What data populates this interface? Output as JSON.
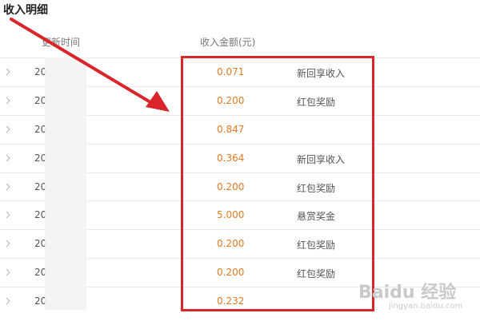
{
  "page": {
    "title": "收入明细"
  },
  "table": {
    "headers": {
      "time": "更新时间",
      "amount": "收入金额(元)"
    },
    "rows": [
      {
        "time": "20",
        "amount": "0.071",
        "source": "新回享收入"
      },
      {
        "time": "20",
        "amount": "0.200",
        "source": "红包奖励"
      },
      {
        "time": "20",
        "amount": "0.847",
        "source": ""
      },
      {
        "time": "20",
        "amount": "0.364",
        "source": "新回享收入"
      },
      {
        "time": "20",
        "amount": "0.200",
        "source": "红包奖励"
      },
      {
        "time": "20",
        "amount": "5.000",
        "source": "悬赏奖金"
      },
      {
        "time": "20",
        "amount": "0.200",
        "source": "红包奖励"
      },
      {
        "time": "20",
        "amount": "0.200",
        "source": "红包奖励"
      },
      {
        "time": "20",
        "amount": "0.232",
        "source": ""
      }
    ]
  },
  "annotation": {
    "highlight_color": "#d8262a",
    "arrow_color": "#d8262a"
  },
  "watermark": {
    "logo_text": "Baidu 经验",
    "url": "jingyan.baidu.com"
  },
  "colors": {
    "amount": "#e07b24",
    "row_border": "#ebebeb"
  }
}
